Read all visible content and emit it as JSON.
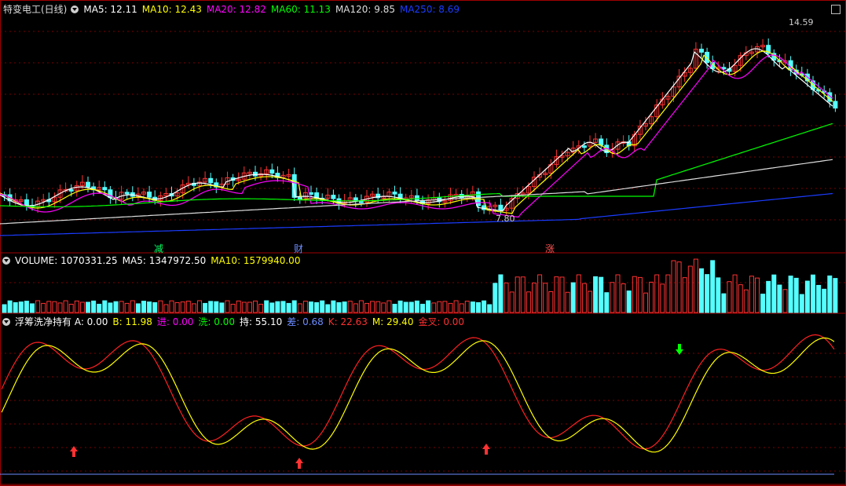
{
  "main": {
    "title": "特变电工(日线)",
    "indicators": [
      {
        "label": "MA5:",
        "value": "12.11",
        "color": "#ffffff"
      },
      {
        "label": "MA10:",
        "value": "12.43",
        "color": "#ffff00"
      },
      {
        "label": "MA20:",
        "value": "12.82",
        "color": "#ff00ff"
      },
      {
        "label": "MA60:",
        "value": "11.13",
        "color": "#00ff00"
      },
      {
        "label": "MA120:",
        "value": "9.85",
        "color": "#dddddd"
      },
      {
        "label": "MA250:",
        "value": "8.69",
        "color": "#1a3cff"
      }
    ],
    "high_label": "14.59",
    "low_label": "7.80",
    "markers": [
      {
        "text": "减",
        "color": "#00ff66"
      },
      {
        "text": "财",
        "color": "#6b8cff"
      },
      {
        "text": "涨",
        "color": "#ff5050"
      }
    ]
  },
  "volume": {
    "items": [
      {
        "label": "VOLUME:",
        "value": "1070331.25",
        "color": "#ffffff"
      },
      {
        "label": "MA5:",
        "value": "1347972.50",
        "color": "#ffffff"
      },
      {
        "label": "MA10:",
        "value": "1579940.00",
        "color": "#ffff00"
      }
    ]
  },
  "indicator": {
    "items": [
      {
        "label": "浮筹洗净持有 A:",
        "value": "0.00",
        "color": "#ffffff"
      },
      {
        "label": "B:",
        "value": "11.98",
        "color": "#ffff00"
      },
      {
        "label": "进:",
        "value": "0.00",
        "color": "#ff00ff"
      },
      {
        "label": "洗:",
        "value": "0.00",
        "color": "#00ff00"
      },
      {
        "label": "持:",
        "value": "55.10",
        "color": "#ffffff"
      },
      {
        "label": "差:",
        "value": "0.68",
        "color": "#6b8cff"
      },
      {
        "label": "K:",
        "value": "22.63",
        "color": "#ff3030"
      },
      {
        "label": "M:",
        "value": "29.40",
        "color": "#ffff00"
      },
      {
        "label": "金叉:",
        "value": "0.00",
        "color": "#ff3030"
      }
    ]
  },
  "colors": {
    "up": "#ff3232",
    "down": "#54ffff",
    "grid": "#7a0000",
    "border": "#a00000"
  },
  "icons": {
    "window_control": "restore-icon"
  }
}
